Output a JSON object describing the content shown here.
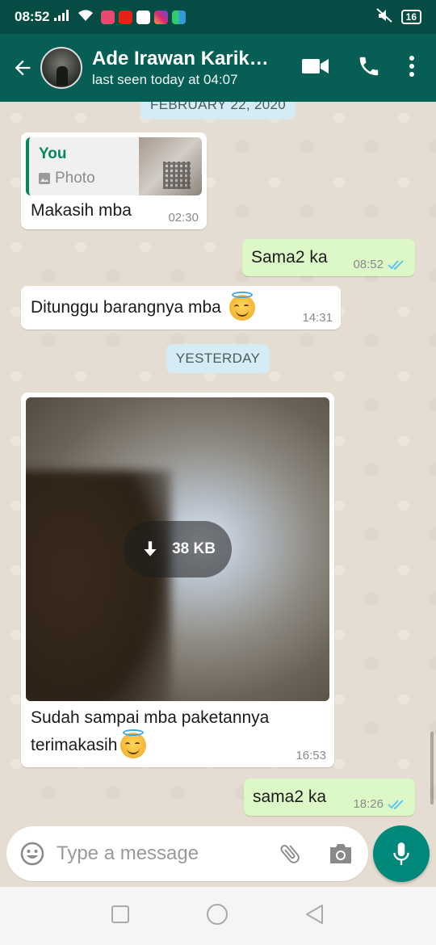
{
  "status_bar": {
    "time": "08:52",
    "battery": "16"
  },
  "contact": {
    "name": "Ade Irawan Karik…",
    "last_seen": "last seen today at 04:07"
  },
  "dates": {
    "top": "FEBRUARY 22, 2020",
    "yesterday": "YESTERDAY"
  },
  "messages": [
    {
      "id": "m1",
      "direction": "in",
      "reply_author": "You",
      "reply_kind": "Photo",
      "text": "Makasih mba",
      "time": "02:30"
    },
    {
      "id": "m2",
      "direction": "out",
      "text": "Sama2 ka",
      "time": "08:52",
      "status": "read"
    },
    {
      "id": "m3",
      "direction": "in",
      "text": "Ditunggu barangnya mba",
      "emoji": "smiling-face-with-halo",
      "time": "14:31"
    },
    {
      "id": "m4",
      "direction": "in",
      "media": "image",
      "download_size": "38 KB",
      "text_line1": "Sudah sampai mba paketannya",
      "text_line2": "terimakasih",
      "emoji": "smiling-face-with-halo",
      "time": "16:53"
    },
    {
      "id": "m5",
      "direction": "out",
      "text": "sama2 ka",
      "time": "18:26",
      "status": "read"
    }
  ],
  "composer": {
    "placeholder": "Type a message"
  },
  "colors": {
    "header": "#075e54",
    "status_bar": "#054d44",
    "outgoing": "#dcf8c6",
    "incoming": "#ffffff",
    "accent": "#00897b",
    "read_ticks": "#4fc3f7"
  }
}
